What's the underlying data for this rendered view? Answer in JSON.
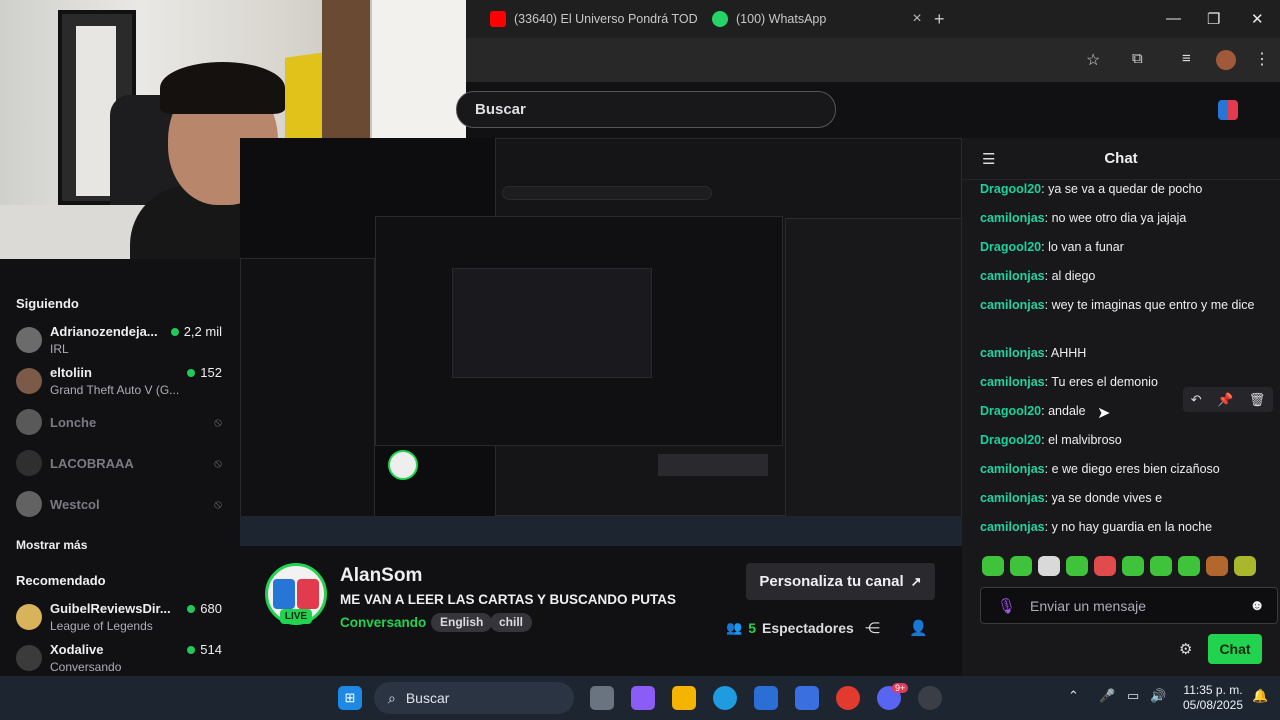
{
  "browser": {
    "tabs": [
      {
        "label": "(33640) El Universo Pondrá TOD",
        "icon": "youtube-icon"
      },
      {
        "label": "(100) WhatsApp",
        "icon": "whatsapp-icon"
      }
    ],
    "new_tab": "+",
    "window_controls": {
      "minimize": "—",
      "maximize": "❐",
      "close": "✕"
    }
  },
  "header": {
    "search_placeholder": "Buscar"
  },
  "sidebar": {
    "following_title": "Siguiendo",
    "following": [
      {
        "name": "Adrianozendeja...",
        "subtitle": "IRL",
        "viewers": "2,2 mil",
        "live": true
      },
      {
        "name": "eltoliin",
        "subtitle": "Grand Theft Auto V (G...",
        "viewers": "152",
        "live": true
      },
      {
        "name": "Lonche",
        "live": false
      },
      {
        "name": "LACOBRAAA",
        "live": false
      },
      {
        "name": "Westcol",
        "live": false
      }
    ],
    "show_more": "Mostrar más",
    "recommended_title": "Recomendado",
    "recommended": [
      {
        "name": "GuibelReviewsDir...",
        "subtitle": "League of Legends",
        "viewers": "680",
        "live": true
      },
      {
        "name": "Xodalive",
        "subtitle": "Conversando",
        "viewers": "514",
        "live": true
      }
    ]
  },
  "stream": {
    "streamer": "AlanSom",
    "live_badge": "LIVE",
    "title": "ME VAN A LEER LAS CARTAS Y BUSCANDO PUTAS",
    "category": "Conversando",
    "tags": [
      "English",
      "chill"
    ],
    "customize_button": "Personaliza tu canal",
    "viewer_count": "5",
    "viewer_label": "Espectadores"
  },
  "chat": {
    "title": "Chat",
    "messages": [
      {
        "user": "Dragool20",
        "text": "ya se va a quedar de pocho"
      },
      {
        "user": "camilonjas",
        "text": "no wee otro dia ya jajaja"
      },
      {
        "user": "Dragool20",
        "text": "lo van a funar"
      },
      {
        "user": "camilonjas",
        "text": "al diego"
      },
      {
        "user": "camilonjas",
        "text": "wey te imaginas que entro y me dice"
      },
      {
        "user": "camilonjas",
        "text": "AHHH"
      },
      {
        "user": "camilonjas",
        "text": "Tu eres el demonio"
      },
      {
        "user": "Dragool20",
        "text": "andale"
      },
      {
        "user": "Dragool20",
        "text": "el malvibroso"
      },
      {
        "user": "camilonjas",
        "text": "e we diego eres bien cizañoso"
      },
      {
        "user": "camilonjas",
        "text": "ya se donde vives e"
      },
      {
        "user": "camilonjas",
        "text": "y no hay guardia en la noche"
      }
    ],
    "input_placeholder": "Enviar un mensaje",
    "send_button": "Chat"
  },
  "taskbar": {
    "search_label": "Buscar",
    "time": "11:35 p. m.",
    "date": "05/08/2025",
    "discord_badge": "9+"
  },
  "colors": {
    "accent": "#22d34f",
    "chat_user": "#22d3a0",
    "background": "#111113"
  }
}
